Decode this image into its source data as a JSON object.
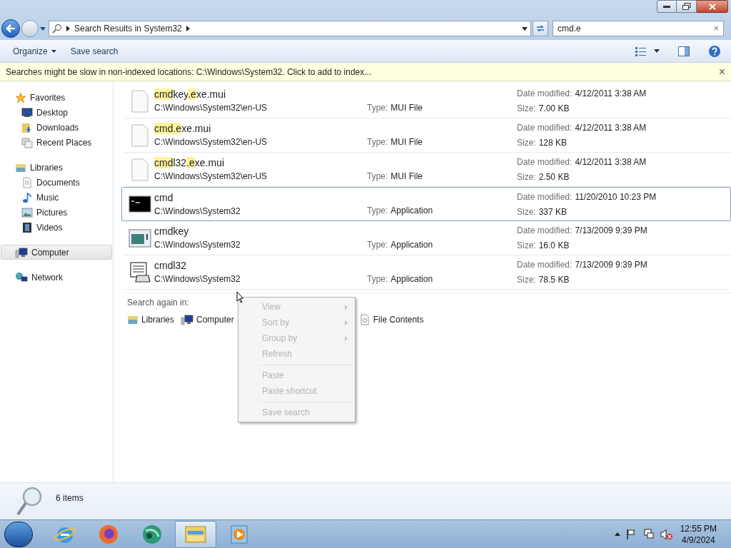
{
  "address_bar": {
    "path": "Search Results in System32"
  },
  "search": {
    "value": "cmd.e",
    "clear": "×"
  },
  "toolbar": {
    "buttons": [
      "Organize",
      "Save search"
    ]
  },
  "info_bar": {
    "text": "Searches might be slow in non-indexed locations: C:\\Windows\\System32. Click to add to index...",
    "close": "×"
  },
  "sidebar": {
    "groups": [
      {
        "label": "Favorites",
        "selected": false,
        "children": [
          {
            "label": "Desktop"
          },
          {
            "label": "Downloads"
          },
          {
            "label": "Recent Places"
          }
        ]
      },
      {
        "label": "Libraries",
        "selected": false,
        "children": [
          {
            "label": "Documents"
          },
          {
            "label": "Music"
          },
          {
            "label": "Pictures"
          },
          {
            "label": "Videos"
          }
        ]
      },
      {
        "label": "Computer",
        "selected": true
      },
      {
        "label": "Network",
        "selected": false
      }
    ]
  },
  "results": [
    {
      "kind": "mui",
      "name": [
        {
          "text": "cmd",
          "highlighted": true
        },
        {
          "text": "key",
          "highlighted": false
        },
        {
          "text": ".e",
          "highlighted": true
        },
        {
          "text": "xe.mui",
          "highlighted": false
        }
      ],
      "path": "C:\\Windows\\System32\\en-US",
      "type_label": "Type:",
      "type": "MUI File",
      "date_label": "Date modified:",
      "date": "4/12/2011 3:38 AM",
      "size_label": "Size:",
      "size": "7.00 KB",
      "selected": false
    },
    {
      "kind": "mui",
      "name": [
        {
          "text": "cmd.e",
          "highlighted": true
        },
        {
          "text": "xe.mui",
          "highlighted": false
        }
      ],
      "path": "C:\\Windows\\System32\\en-US",
      "type_label": "Type:",
      "type": "MUI File",
      "date_label": "Date modified:",
      "date": "4/12/2011 3:38 AM",
      "size_label": "Size:",
      "size": "128 KB",
      "selected": false
    },
    {
      "kind": "mui",
      "name": [
        {
          "text": "cmd",
          "highlighted": true
        },
        {
          "text": "l32",
          "highlighted": false
        },
        {
          "text": ".e",
          "highlighted": true
        },
        {
          "text": "xe.mui",
          "highlighted": false
        }
      ],
      "path": "C:\\Windows\\System32\\en-US",
      "type_label": "Type:",
      "type": "MUI File",
      "date_label": "Date modified:",
      "date": "4/12/2011 3:38 AM",
      "size_label": "Size:",
      "size": "2.50 KB",
      "selected": false
    },
    {
      "kind": "console",
      "name": [
        {
          "text": "cmd",
          "highlighted": false
        }
      ],
      "path": "C:\\Windows\\System32",
      "type_label": "Type:",
      "type": "Application",
      "date_label": "Date modified:",
      "date": "11/20/2010 10:23 PM",
      "size_label": "Size:",
      "size": "337 KB",
      "selected": true
    },
    {
      "kind": "window",
      "name": [
        {
          "text": "cmdkey",
          "highlighted": false
        }
      ],
      "path": "C:\\Windows\\System32",
      "type_label": "Type:",
      "type": "Application",
      "date_label": "Date modified:",
      "date": "7/13/2009 9:39 PM",
      "size_label": "Size:",
      "size": "16.0 KB",
      "selected": false
    },
    {
      "kind": "phone",
      "name": [
        {
          "text": "cmdl32",
          "highlighted": false
        }
      ],
      "path": "C:\\Windows\\System32",
      "type_label": "Type:",
      "type": "Application",
      "date_label": "Date modified:",
      "date": "7/13/2009 9:39 PM",
      "size_label": "Size:",
      "size": "78.5 KB",
      "selected": false
    }
  ],
  "search_again": {
    "label": "Search again in:",
    "locations": [
      {
        "label": "Libraries"
      },
      {
        "label": "Computer"
      },
      {
        "label": "File Contents"
      }
    ]
  },
  "context_menu": {
    "items": [
      {
        "kind": "item",
        "label": "View",
        "submenu": true,
        "disabled": true
      },
      {
        "kind": "item",
        "label": "Sort by",
        "submenu": true,
        "disabled": true
      },
      {
        "kind": "item",
        "label": "Group by",
        "submenu": true,
        "disabled": true
      },
      {
        "kind": "item",
        "label": "Refresh",
        "submenu": false,
        "disabled": true
      },
      {
        "kind": "separator"
      },
      {
        "kind": "item",
        "label": "Paste",
        "submenu": false,
        "disabled": true
      },
      {
        "kind": "item",
        "label": "Paste shortcut",
        "submenu": false,
        "disabled": true
      },
      {
        "kind": "separator"
      },
      {
        "kind": "item",
        "label": "Save search",
        "submenu": false,
        "disabled": true
      }
    ]
  },
  "details_pane": {
    "count": "6 items"
  },
  "taskbar": {
    "apps": [
      {
        "active": false
      },
      {
        "active": false
      },
      {
        "active": false
      },
      {
        "active": true
      },
      {
        "active": false
      }
    ],
    "clock": {
      "time": "12:55 PM",
      "date": "4/9/2024"
    }
  }
}
